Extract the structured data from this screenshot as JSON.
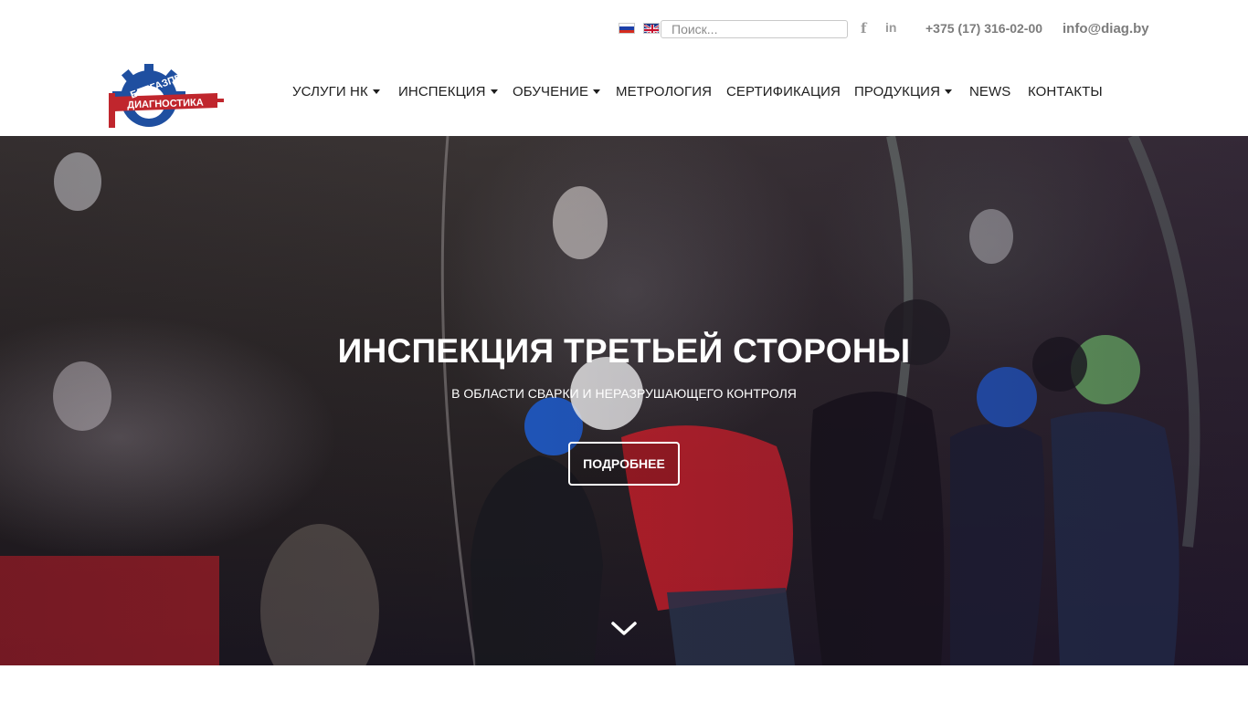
{
  "topbar": {
    "lang_ru": "RU",
    "lang_en": "EN",
    "search_placeholder": "Поиск...",
    "facebook_icon": "facebook-icon",
    "linkedin_icon": "linkedin-icon",
    "phone": "+375 (17) 316-02-00",
    "email": "info@diag.by"
  },
  "logo": {
    "line1": "БЕЛГАЗПРОМ",
    "line2": "ДИАГНОСТИКА",
    "colors": {
      "blue": "#1f4fa0",
      "red": "#c0262d"
    }
  },
  "nav": {
    "items": [
      {
        "label": "УСЛУГИ НК",
        "dropdown": true
      },
      {
        "label": "ИНСПЕКЦИЯ",
        "dropdown": true
      },
      {
        "label": "ОБУЧЕНИЕ",
        "dropdown": true
      },
      {
        "label": "МЕТРОЛОГИЯ",
        "dropdown": false
      },
      {
        "label": "СЕРТИФИКАЦИЯ",
        "dropdown": false
      },
      {
        "label": "ПРОДУКЦИЯ",
        "dropdown": true
      },
      {
        "label": "NEWS",
        "dropdown": false
      },
      {
        "label": "КОНТАКТЫ",
        "dropdown": false
      }
    ]
  },
  "hero": {
    "title": "ИНСПЕКЦИЯ ТРЕТЬЕЙ СТОРОНЫ",
    "subtitle": "В ОБЛАСТИ СВАРКИ И НЕРАЗРУШАЮЩЕГО КОНТРОЛЯ",
    "button_label": "ПОДРОБНЕЕ",
    "scroll_icon": "chevron-down-icon"
  }
}
